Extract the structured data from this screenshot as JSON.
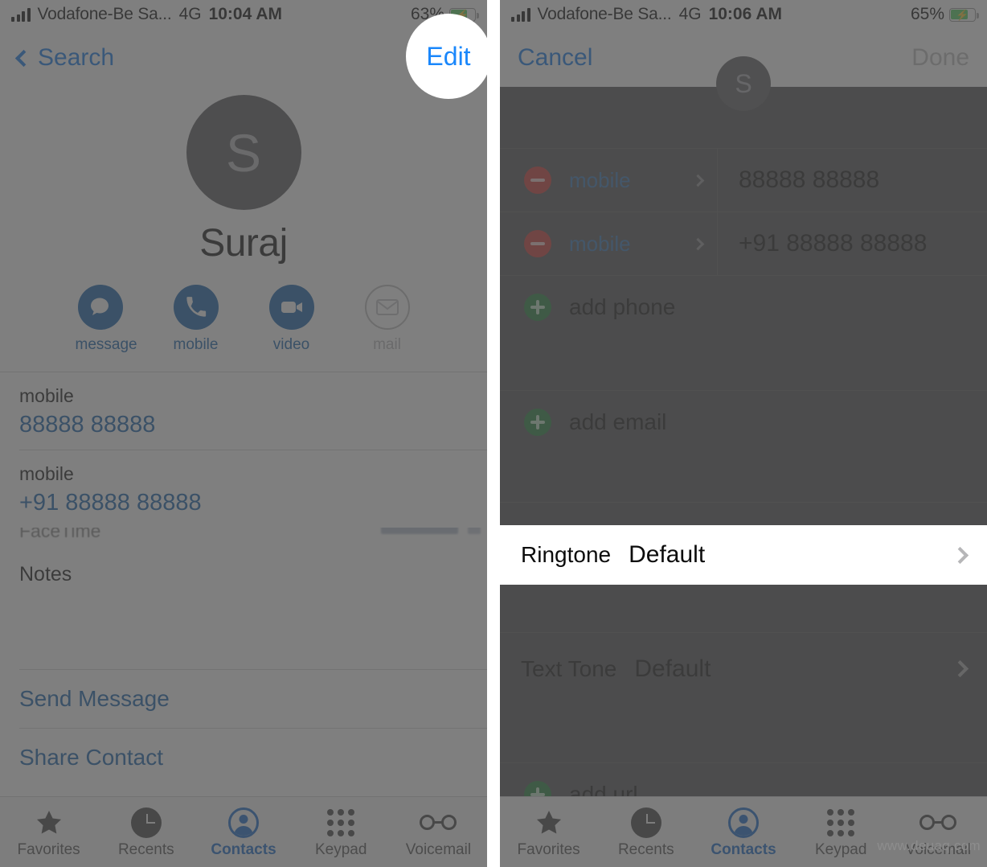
{
  "left": {
    "status": {
      "carrier": "Vodafone-Be Sa...",
      "network": "4G",
      "time": "10:04 AM",
      "battery_pct": "63%",
      "battery_level": 63,
      "charging": true
    },
    "nav": {
      "back_label": "Search",
      "right_label": "Edit"
    },
    "contact": {
      "initial": "S",
      "name": "Suraj",
      "actions": [
        {
          "label": "message",
          "icon": "message-bubble-icon",
          "enabled": true
        },
        {
          "label": "mobile",
          "icon": "phone-handset-icon",
          "enabled": true
        },
        {
          "label": "video",
          "icon": "video-camera-icon",
          "enabled": true
        },
        {
          "label": "mail",
          "icon": "envelope-icon",
          "enabled": false
        }
      ],
      "fields": [
        {
          "label": "mobile",
          "value": "88888 88888"
        },
        {
          "label": "mobile",
          "value": "+91 88888 88888"
        }
      ],
      "clipped_row": "FaceTime",
      "notes_label": "Notes",
      "links": [
        "Send Message",
        "Share Contact"
      ]
    },
    "tabs": [
      {
        "label": "Favorites",
        "icon": "star-icon",
        "active": false
      },
      {
        "label": "Recents",
        "icon": "clock-icon",
        "active": false
      },
      {
        "label": "Contacts",
        "icon": "person-icon",
        "active": true
      },
      {
        "label": "Keypad",
        "icon": "keypad-icon",
        "active": false
      },
      {
        "label": "Voicemail",
        "icon": "voicemail-icon",
        "active": false
      }
    ]
  },
  "right": {
    "status": {
      "carrier": "Vodafone-Be Sa...",
      "network": "4G",
      "time": "10:06 AM",
      "battery_pct": "65%",
      "battery_level": 65,
      "charging": true
    },
    "nav": {
      "cancel_label": "Cancel",
      "done_label": "Done",
      "initial": "S"
    },
    "phone_rows": [
      {
        "label": "mobile",
        "value": "88888 88888"
      },
      {
        "label": "mobile",
        "value": "+91 88888 88888"
      }
    ],
    "add_phone_label": "add phone",
    "add_email_label": "add email",
    "add_url_label": "add url",
    "tone_rows": [
      {
        "name": "Ringtone",
        "value": "Default",
        "highlighted": true
      },
      {
        "name": "Text Tone",
        "value": "Default",
        "highlighted": false
      }
    ],
    "tabs": [
      {
        "label": "Favorites",
        "icon": "star-icon",
        "active": false
      },
      {
        "label": "Recents",
        "icon": "clock-icon",
        "active": false
      },
      {
        "label": "Contacts",
        "icon": "person-icon",
        "active": true
      },
      {
        "label": "Keypad",
        "icon": "keypad-icon",
        "active": false
      },
      {
        "label": "Voicemail",
        "icon": "voicemail-icon",
        "active": false
      }
    ]
  },
  "watermark": "www.deuaq.com",
  "colors": {
    "accent_blue": "#0a72e8",
    "link_blue": "#0b5ca8",
    "dim_overlay": "#4d4d4d",
    "delete_red": "#c9302c",
    "add_green": "#1b7a34",
    "battery_green": "#4cd15c",
    "highlight_white": "#ffffff"
  }
}
